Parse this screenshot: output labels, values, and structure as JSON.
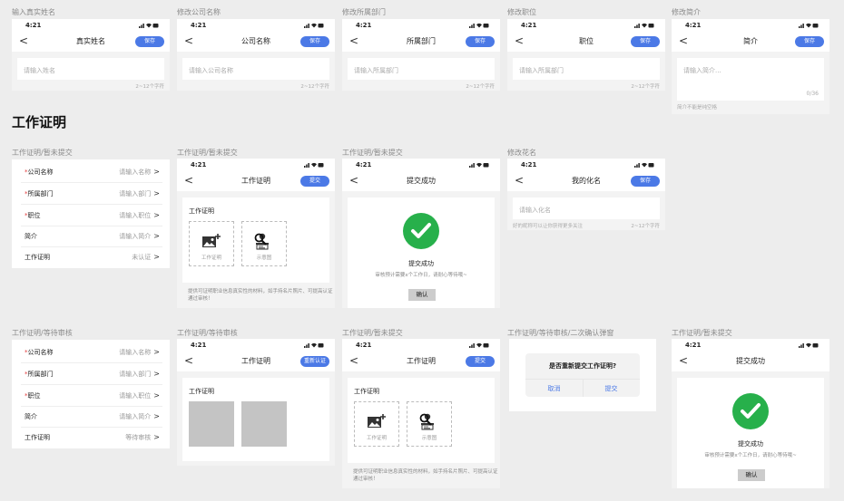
{
  "status_time": "4:21",
  "back_glyph": "<",
  "chevron_glyph": ">",
  "required_mark": "*",
  "captions": {
    "c1": "输入真实姓名",
    "c2": "修改公司名称",
    "c3": "修改所属部门",
    "c4": "修改职位",
    "c5": "修改简介",
    "c6": "工作证明/暂未提交",
    "c7": "工作证明/暂未提交",
    "c8": "工作证明/暂未提交",
    "c9": "修改花名",
    "c10": "工作证明/等待审核",
    "c11": "工作证明/等待审核",
    "c12": "工作证明/暂未提交",
    "c13": "工作证明/等待审核/二次确认弹窗",
    "c14": "工作证明/暂未提交"
  },
  "section_title": "工作证明",
  "top_row": [
    {
      "title": "真实姓名",
      "button": "保存",
      "placeholder": "请输入姓名",
      "hint": "2~12个字符"
    },
    {
      "title": "公司名称",
      "button": "保存",
      "placeholder": "请输入公司名称",
      "hint": "2~12个字符"
    },
    {
      "title": "所属部门",
      "button": "保存",
      "placeholder": "请输入所属部门",
      "hint": "2~12个字符"
    },
    {
      "title": "职位",
      "button": "保存",
      "placeholder": "请输入所属部门",
      "hint": "2~12个字符"
    },
    {
      "title": "简介",
      "button": "保存",
      "placeholder": "请输入简介...",
      "counter": "0/36",
      "hint": "简介不能是纯空格"
    }
  ],
  "form1": [
    {
      "label": "公司名称",
      "required": true,
      "value": "请输入名称"
    },
    {
      "label": "所属部门",
      "required": true,
      "value": "请输入部门"
    },
    {
      "label": "职位",
      "required": true,
      "value": "请输入职位"
    },
    {
      "label": "简介",
      "required": false,
      "value": "请输入简介"
    },
    {
      "label": "工作证明",
      "required": false,
      "value": "未认证"
    }
  ],
  "form2": [
    {
      "label": "公司名称",
      "required": true,
      "value": "请输入名称"
    },
    {
      "label": "所属部门",
      "required": true,
      "value": "请输入部门"
    },
    {
      "label": "职位",
      "required": true,
      "value": "请输入职位"
    },
    {
      "label": "简介",
      "required": false,
      "value": "请输入简介"
    },
    {
      "label": "工作证明",
      "required": false,
      "value": "等待审核"
    }
  ],
  "proof": {
    "title": "工作证明",
    "submit": "提交",
    "recert": "重新认证",
    "card_title": "工作证明",
    "upload_label": "工作证明",
    "sample_label": "示意图",
    "desc": "提供可证明职业信息真实性的材料，如手持名片照片、可提高认证通过审核！"
  },
  "success": {
    "title": "提交成功",
    "heading": "提交成功",
    "sub": "审核预计需要x个工作日，请耐心等待哦~",
    "confirm": "确认"
  },
  "nickname": {
    "title": "我的化名",
    "button": "保存",
    "placeholder": "请输入化名",
    "tip": "好的昵称可以让你获得更多关注",
    "hint": "2~12个字符"
  },
  "dialog": {
    "question": "是否重新提交工作证明?",
    "cancel": "取消",
    "submit": "提交"
  },
  "colors": {
    "accent": "#4b79e6",
    "success": "#27b04b",
    "required": "#e43c3c"
  }
}
